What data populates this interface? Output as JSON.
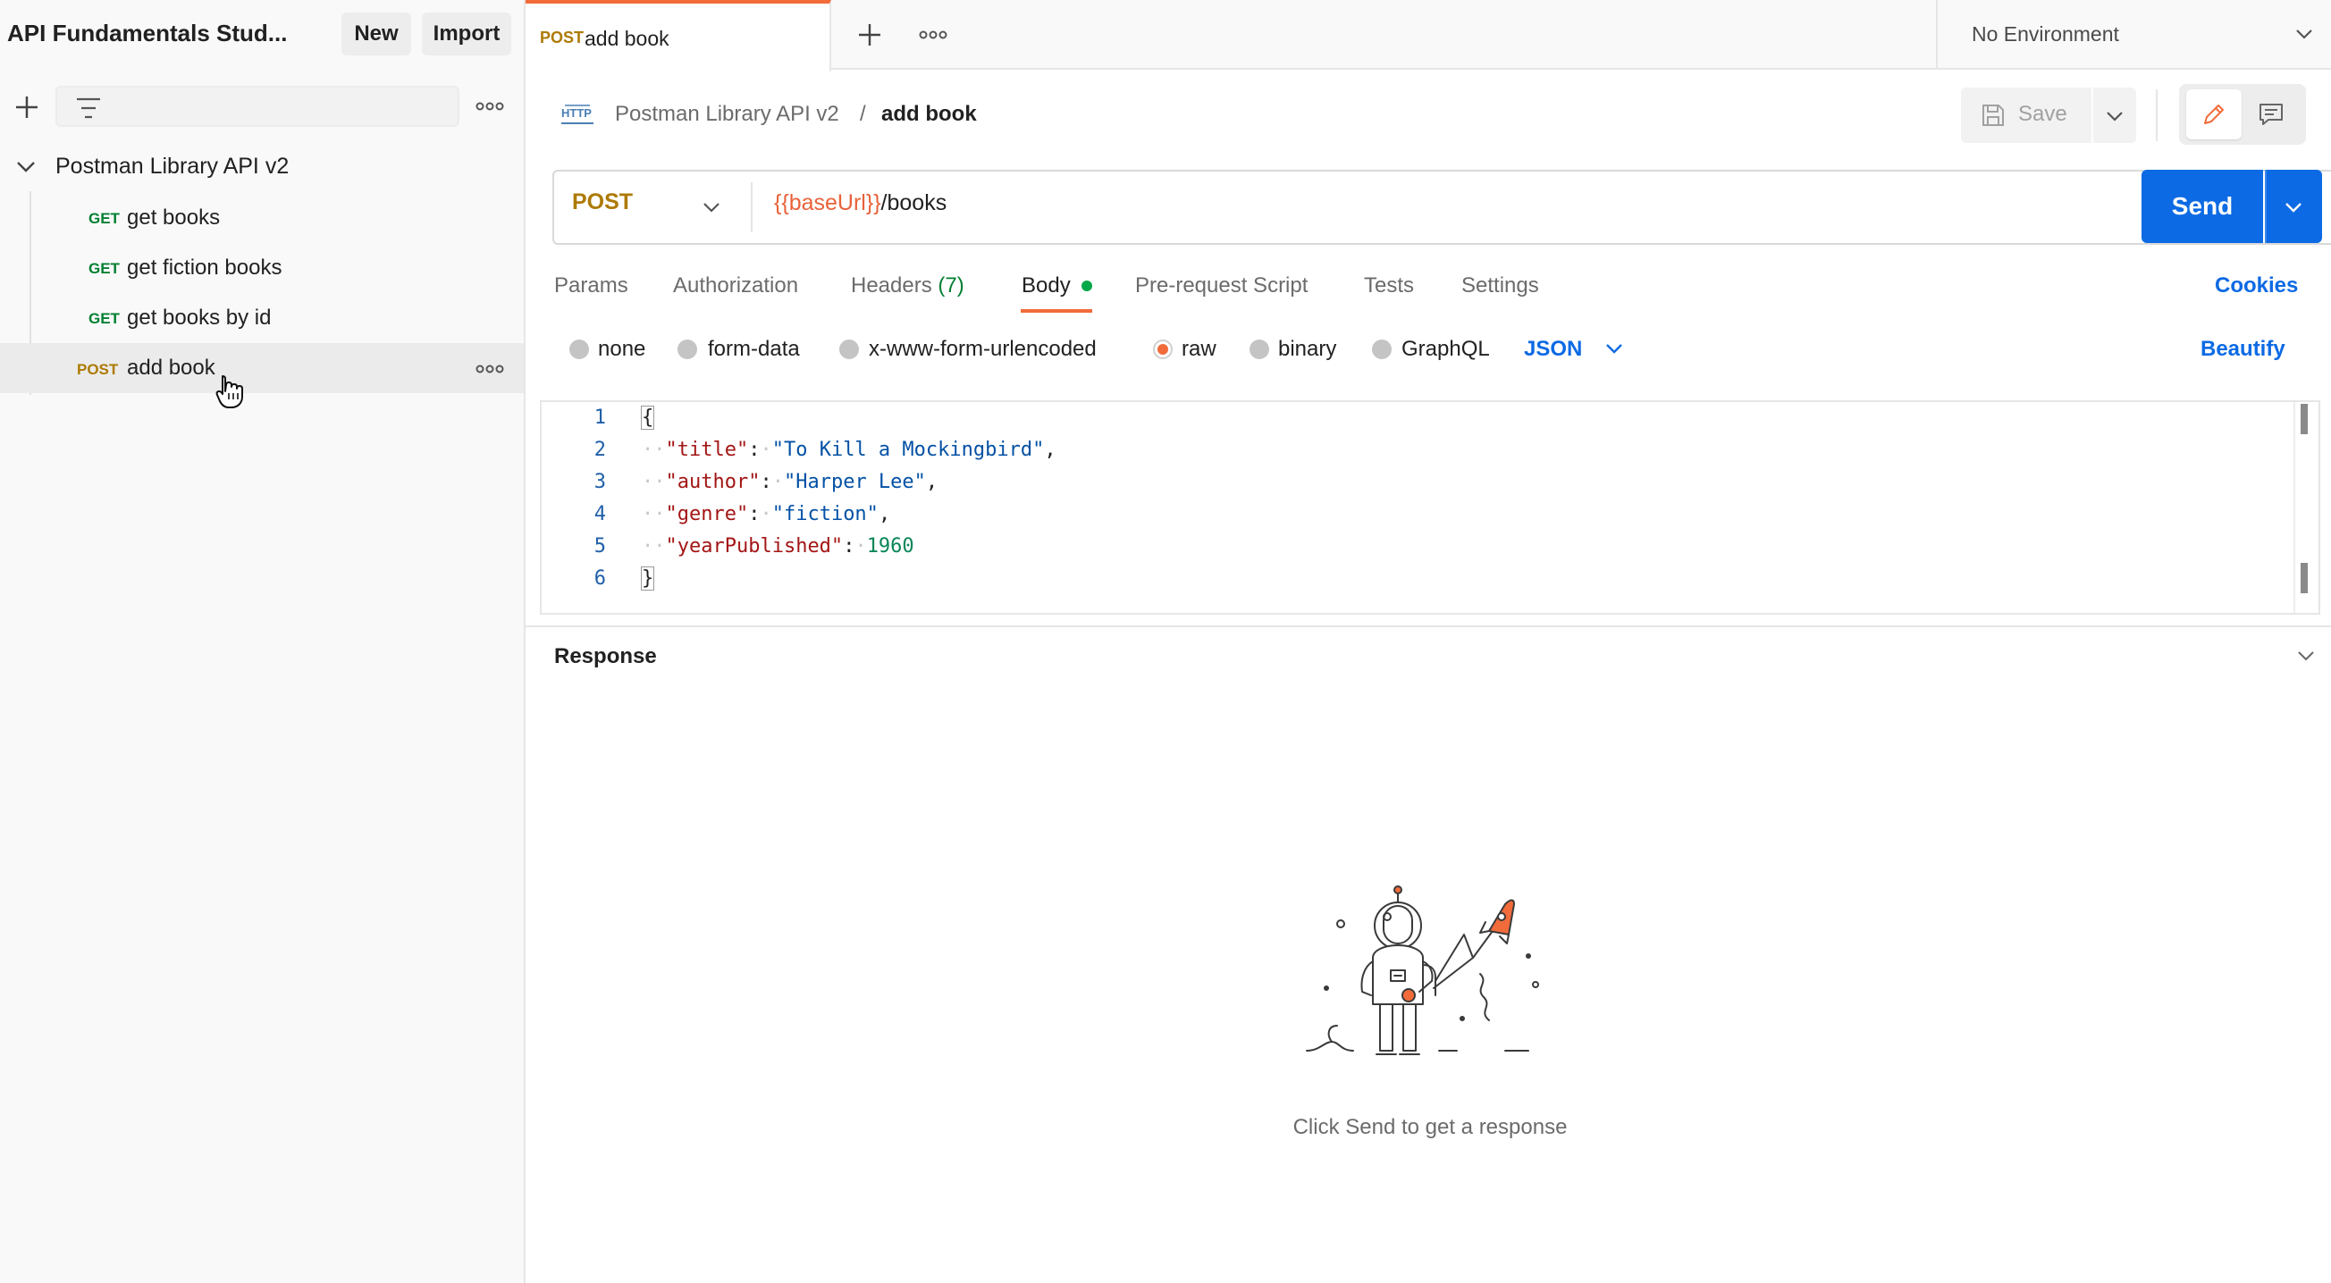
{
  "sidebar": {
    "workspace_title": "API Fundamentals Stud...",
    "new_label": "New",
    "import_label": "Import",
    "search_placeholder": "",
    "collection": {
      "name": "Postman Library API v2",
      "requests": [
        {
          "method": "GET",
          "name": "get books"
        },
        {
          "method": "GET",
          "name": "get fiction books"
        },
        {
          "method": "GET",
          "name": "get books by id"
        },
        {
          "method": "POST",
          "name": "add book"
        }
      ]
    }
  },
  "tabs": {
    "active": {
      "method": "POST",
      "name": "add book"
    },
    "environment": "No Environment"
  },
  "request": {
    "breadcrumb": {
      "collection": "Postman Library API v2",
      "separator": "/",
      "request": "add book"
    },
    "save_label": "Save",
    "method": "POST",
    "url_variable": "{{baseUrl}}",
    "url_path": "/books",
    "send_label": "Send",
    "tabs": {
      "params": "Params",
      "authorization": "Authorization",
      "headers": "Headers",
      "headers_count": "(7)",
      "body": "Body",
      "pre_request": "Pre-request Script",
      "tests": "Tests",
      "settings": "Settings"
    },
    "cookies_label": "Cookies",
    "body_options": {
      "none": "none",
      "form_data": "form-data",
      "urlencoded": "x-www-form-urlencoded",
      "raw": "raw",
      "binary": "binary",
      "graphql": "GraphQL",
      "format": "JSON",
      "selected": "raw"
    },
    "beautify_label": "Beautify",
    "editor": {
      "line_numbers": [
        "1",
        "2",
        "3",
        "4",
        "5",
        "6"
      ],
      "open_brace": "{",
      "close_brace": "}",
      "fields": [
        {
          "key": "\"title\"",
          "value": "\"To Kill a Mockingbird\"",
          "trail": ","
        },
        {
          "key": "\"author\"",
          "value": "\"Harper Lee\"",
          "trail": ","
        },
        {
          "key": "\"genre\"",
          "value": "\"fiction\"",
          "trail": ","
        },
        {
          "key": "\"yearPublished\"",
          "value": "1960",
          "trail": ""
        }
      ]
    }
  },
  "response": {
    "title": "Response",
    "empty_message": "Click Send to get a response"
  },
  "colors": {
    "accent": "#f26b3a",
    "primary_blue": "#0c6ae4",
    "get_method": "#007f31",
    "post_method": "#ad7a03"
  },
  "icons": [
    "plus-icon",
    "filter-icon",
    "more-icon",
    "chevron-down-icon",
    "http-icon",
    "save-icon",
    "pencil-icon",
    "comment-icon",
    "hand-cursor-icon",
    "astronaut-illustration"
  ]
}
